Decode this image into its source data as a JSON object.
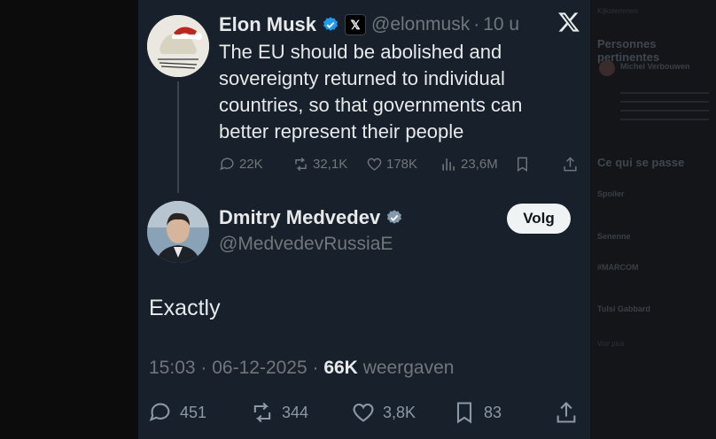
{
  "tweet": {
    "author_name": "Elon Musk",
    "handle": "@elonmusk",
    "separator": "·",
    "time": "10 u",
    "affiliate_badge": "𝕏",
    "text": "The EU should be abolished and sovereignty returned to individual countries, so that governments can better represent their people",
    "replies": "22K",
    "reposts": "32,1K",
    "likes": "178K",
    "views": "23,6M"
  },
  "reply": {
    "author_name": "Dmitry Medvedev",
    "handle": "@MedvedevRussiaE",
    "follow_label": "Volg",
    "text": "Exactly",
    "time": "15:03",
    "date": "06-12-2025",
    "views_count": "66K",
    "views_label": "weergaven",
    "replies": "451",
    "reposts": "344",
    "likes": "3,8K",
    "bookmarks": "83"
  },
  "sidebar": {
    "top_label": "Kijkstemmen",
    "relevant_title": "Personnes pertinentes",
    "relevant_name": "Michel Verbouwen",
    "trends_title": "Ce qui se passe",
    "trend1": "Spoiler",
    "trend2": "Senenne",
    "trend3": "#MARCOM",
    "trend4": "Tulsi Gabbard",
    "more": "Voir plus"
  },
  "icons": {
    "close": "x-logo-icon",
    "verified": "verified-badge-icon",
    "reply": "reply-icon",
    "repost": "repost-icon",
    "like": "heart-icon",
    "views": "views-icon",
    "bookmark": "bookmark-icon",
    "share": "share-icon"
  },
  "colors": {
    "verified_blue": "#1d9bf0",
    "verified_gray": "#829aab",
    "modal_bg": "#17202b"
  }
}
